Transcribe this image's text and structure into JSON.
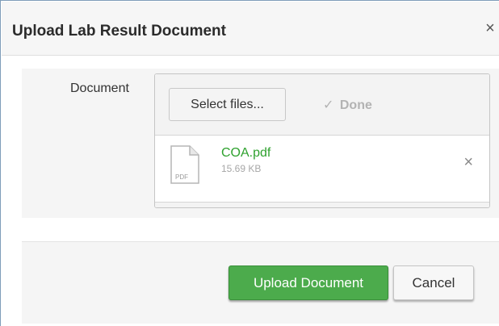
{
  "dialog": {
    "title": "Upload Lab Result Document",
    "close_glyph": "×"
  },
  "form": {
    "document_label": "Document"
  },
  "upload": {
    "select_label": "Select files...",
    "done_check": "✓",
    "done_label": "Done",
    "file": {
      "name": "COA.pdf",
      "size": "15.69 KB",
      "type_label": "PDF",
      "icon": "pdf-file-icon",
      "remove_glyph": "×"
    }
  },
  "footer": {
    "upload_label": "Upload Document",
    "cancel_label": "Cancel"
  },
  "colors": {
    "accent_green": "#4cab4c",
    "file_name_green": "#2ea12e"
  }
}
